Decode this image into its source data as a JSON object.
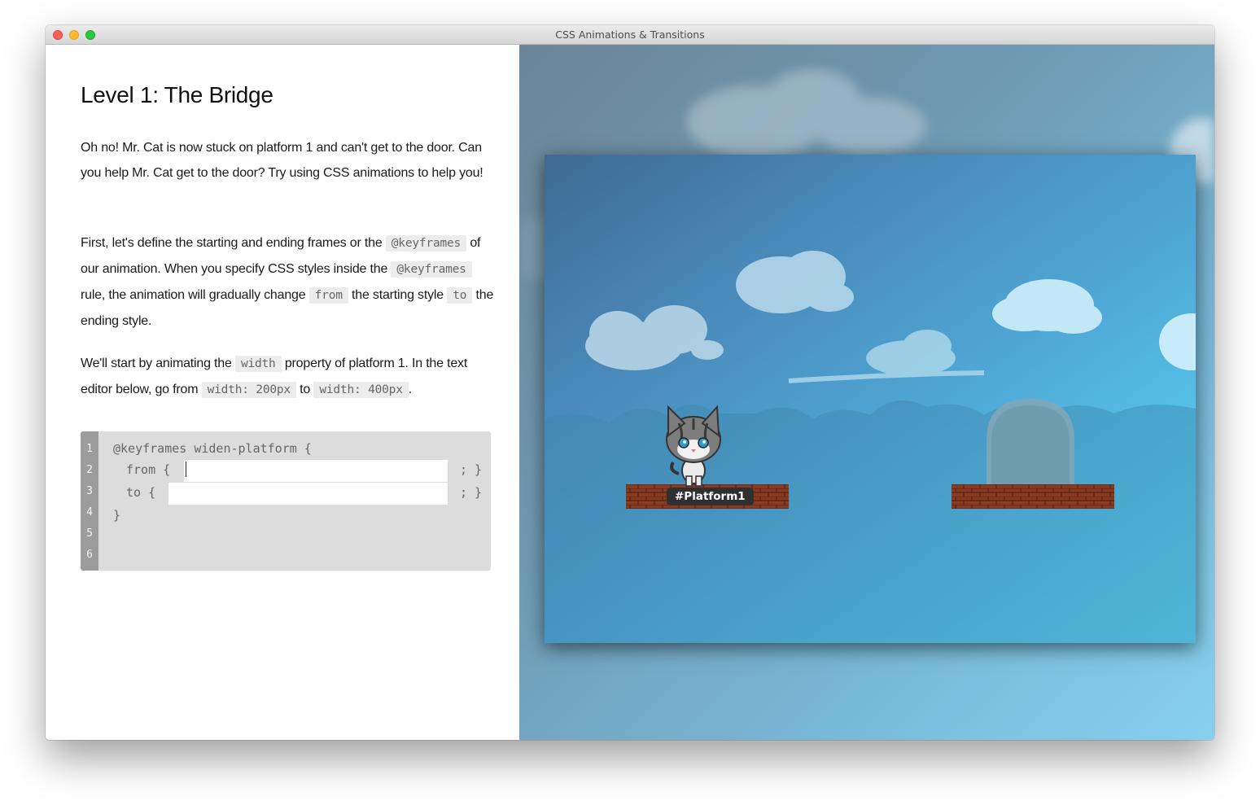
{
  "window": {
    "title": "CSS Animations & Transitions"
  },
  "lesson": {
    "title": "Level 1: The Bridge",
    "p1": "Oh no! Mr. Cat is now stuck on platform 1 and can't get to the door. Can you help Mr. Cat get to the door? Try using CSS animations to help you!",
    "p2": {
      "t1": "First, let's define the starting and ending frames or the ",
      "c1": "@keyframes",
      "t2": " of our animation. When you specify CSS styles inside the ",
      "c2": "@keyframes",
      "t3": " rule, the animation will gradually change ",
      "c3": "from",
      "t4": " the starting style ",
      "c4": "to",
      "t5": " the ending style."
    },
    "p3": {
      "t1": "We'll start by animating the ",
      "c1": "width",
      "t2": " property of platform 1. In the text editor below, go from ",
      "c2": "width: 200px",
      "t3": " to ",
      "c3": "width: 400px",
      "t4": "."
    }
  },
  "editor": {
    "line_numbers": [
      "1",
      "2",
      "3",
      "4",
      "5",
      "6"
    ],
    "line1": "@keyframes widen-platform {",
    "line2_prefix": "from {",
    "line3_prefix": "to {",
    "line_suffix": "; }",
    "line4": "}",
    "from_value": "",
    "to_value": ""
  },
  "game": {
    "platform_label": "#Platform1",
    "colors": {
      "sky_top": "#3f6a92",
      "sky_bottom": "#5fdcf8",
      "brick": "#8b3a22",
      "door": "#7fa6b8"
    }
  }
}
